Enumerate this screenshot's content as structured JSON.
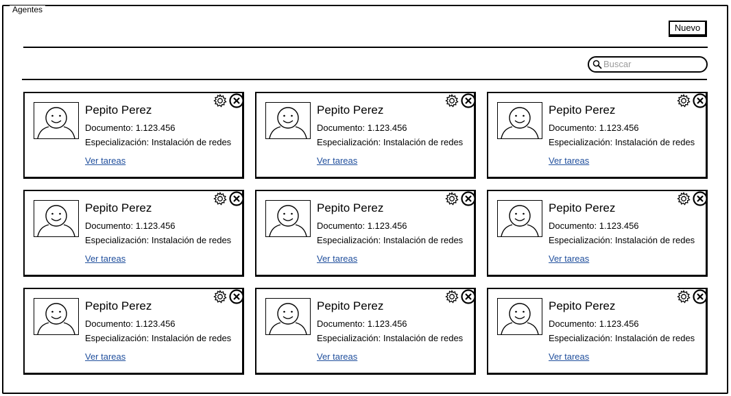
{
  "window": {
    "title": "Agentes"
  },
  "toolbar": {
    "new_label": "Nuevo"
  },
  "search": {
    "placeholder": "Buscar",
    "icon": "search-icon"
  },
  "agents": [
    {
      "name": "Pepito Perez",
      "document": "Documento: 1.123.456",
      "specialization": "Especialización: Instalación de redes",
      "link": "Ver tareas"
    },
    {
      "name": "Pepito Perez",
      "document": "Documento: 1.123.456",
      "specialization": "Especialización: Instalación de redes",
      "link": "Ver tareas"
    },
    {
      "name": "Pepito Perez",
      "document": "Documento: 1.123.456",
      "specialization": "Especialización: Instalación de redes",
      "link": "Ver tareas"
    },
    {
      "name": "Pepito Perez",
      "document": "Documento: 1.123.456",
      "specialization": "Especialización: Instalación de redes",
      "link": "Ver tareas"
    },
    {
      "name": "Pepito Perez",
      "document": "Documento: 1.123.456",
      "specialization": "Especialización: Instalación de redes",
      "link": "Ver tareas"
    },
    {
      "name": "Pepito Perez",
      "document": "Documento: 1.123.456",
      "specialization": "Especialización: Instalación de redes",
      "link": "Ver tareas"
    },
    {
      "name": "Pepito Perez",
      "document": "Documento: 1.123.456",
      "specialization": "Especialización: Instalación de redes",
      "link": "Ver tareas"
    },
    {
      "name": "Pepito Perez",
      "document": "Documento: 1.123.456",
      "specialization": "Especialización: Instalación de redes",
      "link": "Ver tareas"
    },
    {
      "name": "Pepito Perez",
      "document": "Documento: 1.123.456",
      "specialization": "Especialización: Instalación de redes",
      "link": "Ver tareas"
    }
  ],
  "colors": {
    "link": "#1f4e9c",
    "placeholder": "#9a9a9a",
    "stroke": "#000000"
  }
}
